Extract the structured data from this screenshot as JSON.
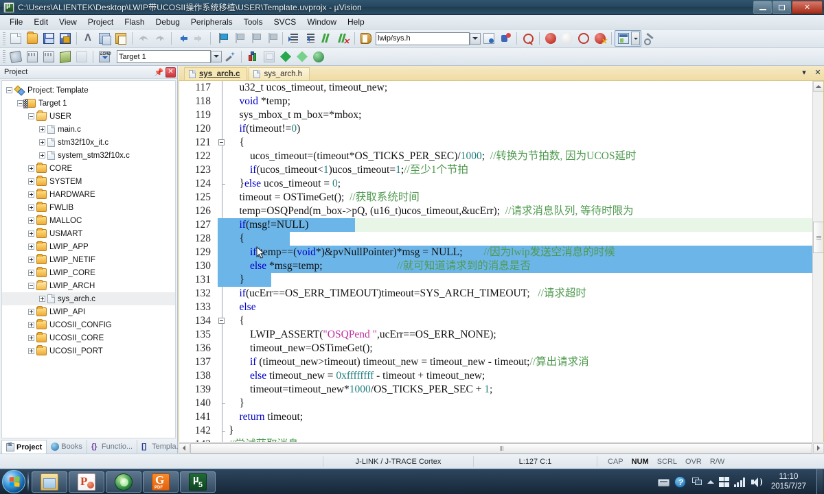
{
  "window": {
    "title": "C:\\Users\\ALIENTEK\\Desktop\\LWIP带UCOSII操作系统移植\\USER\\Template.uvprojx - µVision",
    "app_icon": "uvision-icon",
    "minimize": "minimize-button",
    "maximize": "maximize-button",
    "close": "close-button"
  },
  "menu": {
    "items": [
      "File",
      "Edit",
      "View",
      "Project",
      "Flash",
      "Debug",
      "Peripherals",
      "Tools",
      "SVCS",
      "Window",
      "Help"
    ]
  },
  "toolbar_row1": {
    "buttons": [
      {
        "name": "new-file-icon",
        "kind": "doc"
      },
      {
        "name": "open-file-icon",
        "kind": "folder"
      },
      {
        "name": "save-icon",
        "kind": "save"
      },
      {
        "name": "save-all-icon",
        "kind": "saveall"
      },
      {
        "name": "cut-icon",
        "kind": "cut"
      },
      {
        "name": "copy-icon",
        "kind": "copy"
      },
      {
        "name": "paste-icon",
        "kind": "paste"
      },
      {
        "name": "undo-icon",
        "kind": "undo"
      },
      {
        "name": "redo-icon",
        "kind": "redo"
      },
      {
        "name": "navigate-back-icon",
        "kind": "back"
      },
      {
        "name": "navigate-forward-icon",
        "kind": "fwd"
      },
      {
        "name": "toggle-bookmark-icon",
        "kind": "bm"
      },
      {
        "name": "previous-bookmark-icon",
        "kind": "bmg"
      },
      {
        "name": "next-bookmark-icon",
        "kind": "bmg"
      },
      {
        "name": "clear-bookmarks-icon",
        "kind": "bmg"
      },
      {
        "name": "indent-icon",
        "kind": "ind"
      },
      {
        "name": "outdent-icon",
        "kind": "indout"
      },
      {
        "name": "comment-icon",
        "kind": "cmt"
      },
      {
        "name": "uncomment-icon",
        "kind": "cmtx"
      },
      {
        "name": "open-include-icon",
        "kind": "book"
      }
    ],
    "include_field_value": "lwip/sys.h",
    "extra_buttons": [
      {
        "name": "file-properties-icon",
        "kind": "filed"
      },
      {
        "name": "configuration-wizard-icon",
        "kind": "dbgstart"
      },
      {
        "name": "find-in-files-icon",
        "kind": "findq"
      },
      {
        "name": "insert-breakpoint-icon",
        "kind": "bpt"
      },
      {
        "name": "disable-breakpoint-icon",
        "kind": "bptoff"
      },
      {
        "name": "disable-all-breakpoints-icon",
        "kind": "bptring"
      },
      {
        "name": "kill-all-breakpoints-icon",
        "kind": "bptall"
      },
      {
        "name": "window-layout-icon",
        "kind": "win"
      },
      {
        "name": "customize-tools-icon",
        "kind": "wrench"
      }
    ]
  },
  "toolbar_row2": {
    "buttons": [
      {
        "name": "translate-file-icon",
        "kind": "build"
      },
      {
        "name": "build-target-icon",
        "kind": "build2"
      },
      {
        "name": "rebuild-all-icon",
        "kind": "build2"
      },
      {
        "name": "batch-build-icon",
        "kind": "layers"
      },
      {
        "name": "stop-build-icon",
        "kind": "batch"
      },
      {
        "name": "download-icon",
        "kind": "load"
      }
    ],
    "target_value": "Target 1",
    "after_buttons": [
      {
        "name": "target-options-icon",
        "kind": "magic"
      },
      {
        "name": "manage-project-items-icon",
        "kind": "tgtopt"
      },
      {
        "name": "manage-run-time-env-icon",
        "kind": "mgr"
      },
      {
        "name": "multi-project-icon",
        "kind": "dia"
      },
      {
        "name": "pack-installer-icon",
        "kind": "dialt"
      },
      {
        "name": "manage-components-icon",
        "kind": "diaball"
      }
    ]
  },
  "project_panel": {
    "title": "Project",
    "pin_icon": "pin-icon",
    "close_icon": "close-icon",
    "tree": [
      {
        "label": "Project: Template",
        "depth": 0,
        "icon": "project-icon",
        "expander": "minus"
      },
      {
        "label": "Target 1",
        "depth": 1,
        "icon": "target-icon",
        "expander": "minus"
      },
      {
        "label": "USER",
        "depth": 2,
        "icon": "folder-open-icon",
        "expander": "minus"
      },
      {
        "label": "main.c",
        "depth": 3,
        "icon": "file-icon",
        "expander": "plus"
      },
      {
        "label": "stm32f10x_it.c",
        "depth": 3,
        "icon": "file-icon",
        "expander": "plus"
      },
      {
        "label": "system_stm32f10x.c",
        "depth": 3,
        "icon": "file-icon",
        "expander": "plus"
      },
      {
        "label": "CORE",
        "depth": 2,
        "icon": "folder-icon",
        "expander": "plus"
      },
      {
        "label": "SYSTEM",
        "depth": 2,
        "icon": "folder-icon",
        "expander": "plus"
      },
      {
        "label": "HARDWARE",
        "depth": 2,
        "icon": "folder-icon",
        "expander": "plus"
      },
      {
        "label": "FWLIB",
        "depth": 2,
        "icon": "folder-icon",
        "expander": "plus"
      },
      {
        "label": "MALLOC",
        "depth": 2,
        "icon": "folder-icon",
        "expander": "plus"
      },
      {
        "label": "USMART",
        "depth": 2,
        "icon": "folder-icon",
        "expander": "plus"
      },
      {
        "label": "LWIP_APP",
        "depth": 2,
        "icon": "folder-icon",
        "expander": "plus"
      },
      {
        "label": "LWIP_NETIF",
        "depth": 2,
        "icon": "folder-icon",
        "expander": "plus"
      },
      {
        "label": "LWIP_CORE",
        "depth": 2,
        "icon": "folder-icon",
        "expander": "plus"
      },
      {
        "label": "LWIP_ARCH",
        "depth": 2,
        "icon": "folder-open-icon",
        "expander": "minus"
      },
      {
        "label": "sys_arch.c",
        "depth": 3,
        "icon": "file-icon",
        "expander": "plus",
        "selected": true
      },
      {
        "label": "LWIP_API",
        "depth": 2,
        "icon": "folder-icon",
        "expander": "plus"
      },
      {
        "label": "UCOSII_CONFIG",
        "depth": 2,
        "icon": "folder-icon",
        "expander": "plus"
      },
      {
        "label": "UCOSII_CORE",
        "depth": 2,
        "icon": "folder-icon",
        "expander": "plus"
      },
      {
        "label": "UCOSII_PORT",
        "depth": 2,
        "icon": "folder-icon",
        "expander": "plus"
      }
    ],
    "tabs": [
      {
        "label": "Project",
        "icon": "project-tab-icon",
        "active": true
      },
      {
        "label": "Books",
        "icon": "books-tab-icon",
        "active": false
      },
      {
        "label": "Functio...",
        "icon": "functions-tab-icon",
        "active": false
      },
      {
        "label": "Templa...",
        "icon": "templates-tab-icon",
        "active": false
      }
    ]
  },
  "editor": {
    "tabs": [
      {
        "label": "sys_arch.c",
        "active": true
      },
      {
        "label": "sys_arch.h",
        "active": false
      }
    ],
    "tab_menu_icon": "chevron-down-icon",
    "tab_close_icon": "close-icon",
    "first_line": 117,
    "selection_lines": [
      127,
      128,
      129,
      130,
      131
    ],
    "current_line": 127,
    "lines": [
      {
        "n": 117,
        "fold": "",
        "tokens": [
          {
            "t": "    u32_t ucos_timeout, timeout_new;",
            "c": "txt"
          }
        ]
      },
      {
        "n": 118,
        "fold": "",
        "tokens": [
          {
            "t": "    ",
            "c": "txt"
          },
          {
            "t": "void",
            "c": "kw"
          },
          {
            "t": " *temp;",
            "c": "txt"
          }
        ]
      },
      {
        "n": 119,
        "fold": "",
        "tokens": [
          {
            "t": "    sys_mbox_t m_box=*mbox;",
            "c": "txt"
          }
        ]
      },
      {
        "n": 120,
        "fold": "",
        "tokens": [
          {
            "t": "    ",
            "c": "txt"
          },
          {
            "t": "if",
            "c": "kw"
          },
          {
            "t": "(timeout!=",
            "c": "txt"
          },
          {
            "t": "0",
            "c": "num"
          },
          {
            "t": ")",
            "c": "txt"
          }
        ]
      },
      {
        "n": 121,
        "fold": "box",
        "tokens": [
          {
            "t": "    {",
            "c": "txt"
          }
        ]
      },
      {
        "n": 122,
        "fold": "line",
        "tokens": [
          {
            "t": "        ucos_timeout=(timeout*OS_TICKS_PER_SEC)/",
            "c": "txt"
          },
          {
            "t": "1000",
            "c": "num"
          },
          {
            "t": ";  ",
            "c": "txt"
          },
          {
            "t": "//转换为节拍数, 因为UCOS延时",
            "c": "cmt"
          }
        ]
      },
      {
        "n": 123,
        "fold": "line",
        "tokens": [
          {
            "t": "        ",
            "c": "txt"
          },
          {
            "t": "if",
            "c": "kw"
          },
          {
            "t": "(ucos_timeout<",
            "c": "txt"
          },
          {
            "t": "1",
            "c": "num"
          },
          {
            "t": ")ucos_timeout=",
            "c": "txt"
          },
          {
            "t": "1",
            "c": "num"
          },
          {
            "t": ";",
            "c": "txt"
          },
          {
            "t": "//至少1个节拍",
            "c": "cmt"
          }
        ]
      },
      {
        "n": 124,
        "fold": "tick",
        "tokens": [
          {
            "t": "    }",
            "c": "txt"
          },
          {
            "t": "else",
            "c": "kw"
          },
          {
            "t": " ucos_timeout = ",
            "c": "txt"
          },
          {
            "t": "0",
            "c": "num"
          },
          {
            "t": ";",
            "c": "txt"
          }
        ]
      },
      {
        "n": 125,
        "fold": "line",
        "tokens": [
          {
            "t": "    timeout = OSTimeGet();  ",
            "c": "txt"
          },
          {
            "t": "//获取系统时间",
            "c": "cmt"
          }
        ]
      },
      {
        "n": 126,
        "fold": "line",
        "tokens": [
          {
            "t": "    temp=OSQPend(m_box->pQ, (u16_t)ucos_timeout,&ucErr);  ",
            "c": "txt"
          },
          {
            "t": "//请求消息队列, 等待时限为",
            "c": "cmt"
          }
        ]
      },
      {
        "n": 127,
        "fold": "line",
        "tokens": [
          {
            "t": "    ",
            "c": "txt"
          },
          {
            "t": "if",
            "c": "kw"
          },
          {
            "t": "(msg!=NULL)",
            "c": "txt"
          }
        ]
      },
      {
        "n": 128,
        "fold": "box",
        "tokens": [
          {
            "t": "    {",
            "c": "txt"
          }
        ]
      },
      {
        "n": 129,
        "fold": "line",
        "tokens": [
          {
            "t": "        ",
            "c": "txt"
          },
          {
            "t": "if",
            "c": "kw"
          },
          {
            "t": "(temp==(",
            "c": "txt"
          },
          {
            "t": "void",
            "c": "kw"
          },
          {
            "t": "*)&pvNullPointer)*msg = NULL;        ",
            "c": "txt"
          },
          {
            "t": "//因为lwip发送空消息的时候",
            "c": "cmt"
          }
        ]
      },
      {
        "n": 130,
        "fold": "line",
        "tokens": [
          {
            "t": "        ",
            "c": "txt"
          },
          {
            "t": "else",
            "c": "kw"
          },
          {
            "t": " *msg=temp;                            ",
            "c": "txt"
          },
          {
            "t": "//就可知道请求到的消息是否",
            "c": "cmt"
          }
        ]
      },
      {
        "n": 131,
        "fold": "tick",
        "tokens": [
          {
            "t": "    }",
            "c": "txt"
          }
        ]
      },
      {
        "n": 132,
        "fold": "line",
        "tokens": [
          {
            "t": "    ",
            "c": "txt"
          },
          {
            "t": "if",
            "c": "kw"
          },
          {
            "t": "(ucErr==OS_ERR_TIMEOUT)timeout=SYS_ARCH_TIMEOUT;   ",
            "c": "txt"
          },
          {
            "t": "//请求超时",
            "c": "cmt"
          }
        ]
      },
      {
        "n": 133,
        "fold": "line",
        "tokens": [
          {
            "t": "    ",
            "c": "txt"
          },
          {
            "t": "else",
            "c": "kw"
          }
        ]
      },
      {
        "n": 134,
        "fold": "box",
        "tokens": [
          {
            "t": "    {",
            "c": "txt"
          }
        ]
      },
      {
        "n": 135,
        "fold": "line",
        "tokens": [
          {
            "t": "        LWIP_ASSERT(",
            "c": "txt"
          },
          {
            "t": "\"OSQPend \"",
            "c": "str"
          },
          {
            "t": ",ucErr==OS_ERR_NONE);",
            "c": "txt"
          }
        ]
      },
      {
        "n": 136,
        "fold": "line",
        "tokens": [
          {
            "t": "        timeout_new=OSTimeGet();",
            "c": "txt"
          }
        ]
      },
      {
        "n": 137,
        "fold": "line",
        "tokens": [
          {
            "t": "        ",
            "c": "txt"
          },
          {
            "t": "if",
            "c": "kw"
          },
          {
            "t": " (timeout_new>timeout) timeout_new = timeout_new - timeout;",
            "c": "txt"
          },
          {
            "t": "//算出请求消",
            "c": "cmt"
          }
        ]
      },
      {
        "n": 138,
        "fold": "line",
        "tokens": [
          {
            "t": "        ",
            "c": "txt"
          },
          {
            "t": "else",
            "c": "kw"
          },
          {
            "t": " timeout_new = ",
            "c": "txt"
          },
          {
            "t": "0xffffffff",
            "c": "num"
          },
          {
            "t": " - timeout + timeout_new;",
            "c": "txt"
          }
        ]
      },
      {
        "n": 139,
        "fold": "line",
        "tokens": [
          {
            "t": "        timeout=timeout_new*",
            "c": "txt"
          },
          {
            "t": "1000",
            "c": "num"
          },
          {
            "t": "/OS_TICKS_PER_SEC + ",
            "c": "txt"
          },
          {
            "t": "1",
            "c": "num"
          },
          {
            "t": ";",
            "c": "txt"
          }
        ]
      },
      {
        "n": 140,
        "fold": "tick",
        "tokens": [
          {
            "t": "    }",
            "c": "txt"
          }
        ]
      },
      {
        "n": 141,
        "fold": "line",
        "tokens": [
          {
            "t": "    ",
            "c": "txt"
          },
          {
            "t": "return",
            "c": "kw"
          },
          {
            "t": " timeout;",
            "c": "txt"
          }
        ]
      },
      {
        "n": 142,
        "fold": "end",
        "tokens": [
          {
            "t": "}",
            "c": "txt"
          }
        ]
      },
      {
        "n": 143,
        "fold": "",
        "tokens": [
          {
            "t": "//尝试获取消息",
            "c": "cmt"
          }
        ]
      }
    ]
  },
  "statusbar": {
    "debugger": "J-LINK / J-TRACE Cortex",
    "position": "L:127 C:1",
    "indicators": [
      {
        "label": "CAP",
        "on": false
      },
      {
        "label": "NUM",
        "on": true
      },
      {
        "label": "SCRL",
        "on": false
      },
      {
        "label": "OVR",
        "on": false
      },
      {
        "label": "R/W",
        "on": false
      }
    ]
  },
  "taskbar": {
    "start_label": "start-orb",
    "apps": [
      {
        "name": "taskbar-explorer",
        "icon": "explorer"
      },
      {
        "name": "taskbar-powerpoint",
        "icon": "ppt"
      },
      {
        "name": "taskbar-browser",
        "icon": "browser"
      },
      {
        "name": "taskbar-pdf-reader",
        "icon": "pdf"
      },
      {
        "name": "taskbar-keil-uvision",
        "icon": "keil"
      }
    ],
    "tray": [
      {
        "name": "keyboard-layout-icon"
      },
      {
        "name": "help-icon"
      },
      {
        "name": "windows-stack-icon"
      },
      {
        "name": "show-hidden-icons-icon"
      },
      {
        "name": "network-icon"
      },
      {
        "name": "signal-icon"
      },
      {
        "name": "volume-icon"
      }
    ],
    "time": "11:10",
    "date": "2015/7/27"
  },
  "colors": {
    "keyword": "#0000c8",
    "comment": "#4f9a4f",
    "string": "#c030a0",
    "number": "#1f7f7f",
    "selection": "#6cb5e8",
    "current_line": "#e7f6e7",
    "tab_active": "#f7e7b2"
  }
}
